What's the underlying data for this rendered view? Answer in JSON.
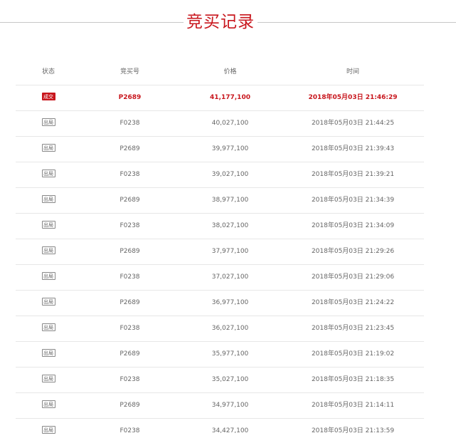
{
  "title": "竞买记录",
  "colors": {
    "accent": "#c8161d",
    "text": "#666666",
    "divider": "#e7e7e7"
  },
  "table": {
    "headers": {
      "status": "状态",
      "bidder": "竞买号",
      "price": "价格",
      "time": "时间"
    },
    "rows": [
      {
        "status": "成交",
        "status_type": "win",
        "bidder": "P2689",
        "price": "41,177,100",
        "time": "2018年05月03日 21:46:29"
      },
      {
        "status": "出局",
        "status_type": "bid",
        "bidder": "F0238",
        "price": "40,027,100",
        "time": "2018年05月03日 21:44:25"
      },
      {
        "status": "出局",
        "status_type": "bid",
        "bidder": "P2689",
        "price": "39,977,100",
        "time": "2018年05月03日 21:39:43"
      },
      {
        "status": "出局",
        "status_type": "bid",
        "bidder": "F0238",
        "price": "39,027,100",
        "time": "2018年05月03日 21:39:21"
      },
      {
        "status": "出局",
        "status_type": "bid",
        "bidder": "P2689",
        "price": "38,977,100",
        "time": "2018年05月03日 21:34:39"
      },
      {
        "status": "出局",
        "status_type": "bid",
        "bidder": "F0238",
        "price": "38,027,100",
        "time": "2018年05月03日 21:34:09"
      },
      {
        "status": "出局",
        "status_type": "bid",
        "bidder": "P2689",
        "price": "37,977,100",
        "time": "2018年05月03日 21:29:26"
      },
      {
        "status": "出局",
        "status_type": "bid",
        "bidder": "F0238",
        "price": "37,027,100",
        "time": "2018年05月03日 21:29:06"
      },
      {
        "status": "出局",
        "status_type": "bid",
        "bidder": "P2689",
        "price": "36,977,100",
        "time": "2018年05月03日 21:24:22"
      },
      {
        "status": "出局",
        "status_type": "bid",
        "bidder": "F0238",
        "price": "36,027,100",
        "time": "2018年05月03日 21:23:45"
      },
      {
        "status": "出局",
        "status_type": "bid",
        "bidder": "P2689",
        "price": "35,977,100",
        "time": "2018年05月03日 21:19:02"
      },
      {
        "status": "出局",
        "status_type": "bid",
        "bidder": "F0238",
        "price": "35,027,100",
        "time": "2018年05月03日 21:18:35"
      },
      {
        "status": "出局",
        "status_type": "bid",
        "bidder": "P2689",
        "price": "34,977,100",
        "time": "2018年05月03日 21:14:11"
      },
      {
        "status": "出局",
        "status_type": "bid",
        "bidder": "F0238",
        "price": "34,427,100",
        "time": "2018年05月03日 21:13:59"
      }
    ]
  }
}
